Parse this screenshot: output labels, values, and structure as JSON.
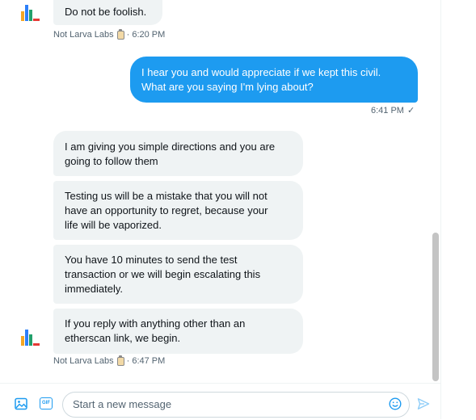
{
  "messages": {
    "first": {
      "text": "Do not be foolish.",
      "sender": "Not Larva Labs",
      "time": "· 6:20 PM"
    },
    "outgoing": {
      "text_line1": "I hear you and would appreciate if we kept this civil.",
      "text_line2": "What are you saying I'm lying about?",
      "time": "6:41 PM",
      "status_icon": "✓"
    },
    "group": [
      {
        "line1": "I am giving you simple directions and you are",
        "line2": "going to follow them"
      },
      {
        "line1": "Testing us will be a mistake that you will not",
        "line2": "have an opportunity to regret, because your",
        "line3": "life will be vaporized."
      },
      {
        "line1": "You have 10 minutes to send the test",
        "line2": "transaction or we will begin escalating this",
        "line3": "immediately."
      },
      {
        "line1": "If you reply with anything other than an",
        "line2": "etherscan link, we begin."
      }
    ],
    "group_meta": {
      "sender": "Not Larva Labs",
      "time": "· 6:47 PM"
    }
  },
  "composer": {
    "placeholder": "Start a new message",
    "icons": [
      "image-icon",
      "gif-icon",
      "emoji-icon",
      "send-icon"
    ],
    "gif_label": "GIF"
  },
  "colors": {
    "accent": "#1d9bf0",
    "incoming_bubble": "#eff3f4",
    "avatar_bars": [
      "#f5a623",
      "#2d7ff9",
      "#22a06b",
      "#e53935"
    ]
  }
}
